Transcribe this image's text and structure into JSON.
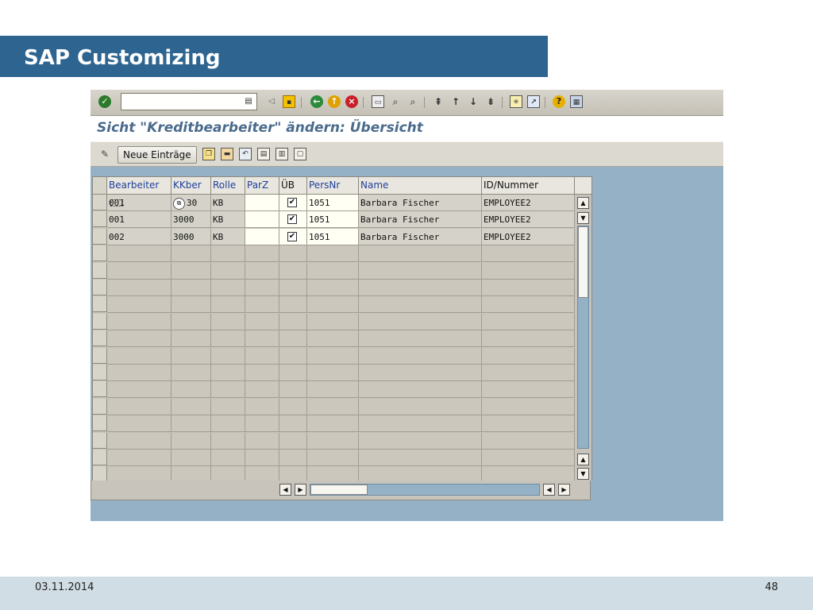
{
  "slide": {
    "title": "SAP Customizing",
    "date": "03.11.2014",
    "page_number": "48",
    "colors": {
      "title_bar": "#2e6590",
      "footer": "#d0dde4",
      "sap_background": "#94b1c6"
    }
  },
  "sap": {
    "system_toolbar": {
      "command_field_value": "",
      "icons": [
        "enter-icon",
        "command-dropdown-icon",
        "collapse-icon",
        "save-icon",
        "back-icon",
        "exit-icon",
        "cancel-icon",
        "print-icon",
        "find-icon",
        "find-next-icon",
        "first-page-icon",
        "previous-page-icon",
        "next-page-icon",
        "last-page-icon",
        "new-session-icon",
        "shortcut-icon",
        "help-icon",
        "layout-icon"
      ]
    },
    "screen_title": "Sicht \"Kreditbearbeiter\" ändern: Übersicht",
    "app_toolbar": {
      "new_entries_label": "Neue Einträge",
      "icons": [
        "change-display-icon",
        "copy-as-icon",
        "delete-icon",
        "undo-icon",
        "select-all-icon",
        "select-block-icon",
        "deselect-all-icon"
      ]
    },
    "table": {
      "columns": [
        "Bearbeiter",
        "KKber",
        "Rolle",
        "ParZ",
        "ÜB",
        "PersNr",
        "Name",
        "ID/Nummer"
      ],
      "rows": [
        {
          "bearbeiter": "001",
          "kkber": "3000",
          "rolle": "KB",
          "parz": "",
          "ueb": true,
          "persnr": "1051",
          "name": "Barbara Fischer",
          "id_nummer": "EMPLOYEE2"
        },
        {
          "bearbeiter": "001",
          "kkber": "3000",
          "rolle": "KB",
          "parz": "",
          "ueb": true,
          "persnr": "1051",
          "name": "Barbara Fischer",
          "id_nummer": "EMPLOYEE2"
        },
        {
          "bearbeiter": "002",
          "kkber": "3000",
          "rolle": "KB",
          "parz": "",
          "ueb": true,
          "persnr": "1051",
          "name": "Barbara Fischer",
          "id_nummer": "EMPLOYEE2"
        }
      ],
      "empty_rows": 14,
      "first_row_kkber_display": "30"
    }
  }
}
